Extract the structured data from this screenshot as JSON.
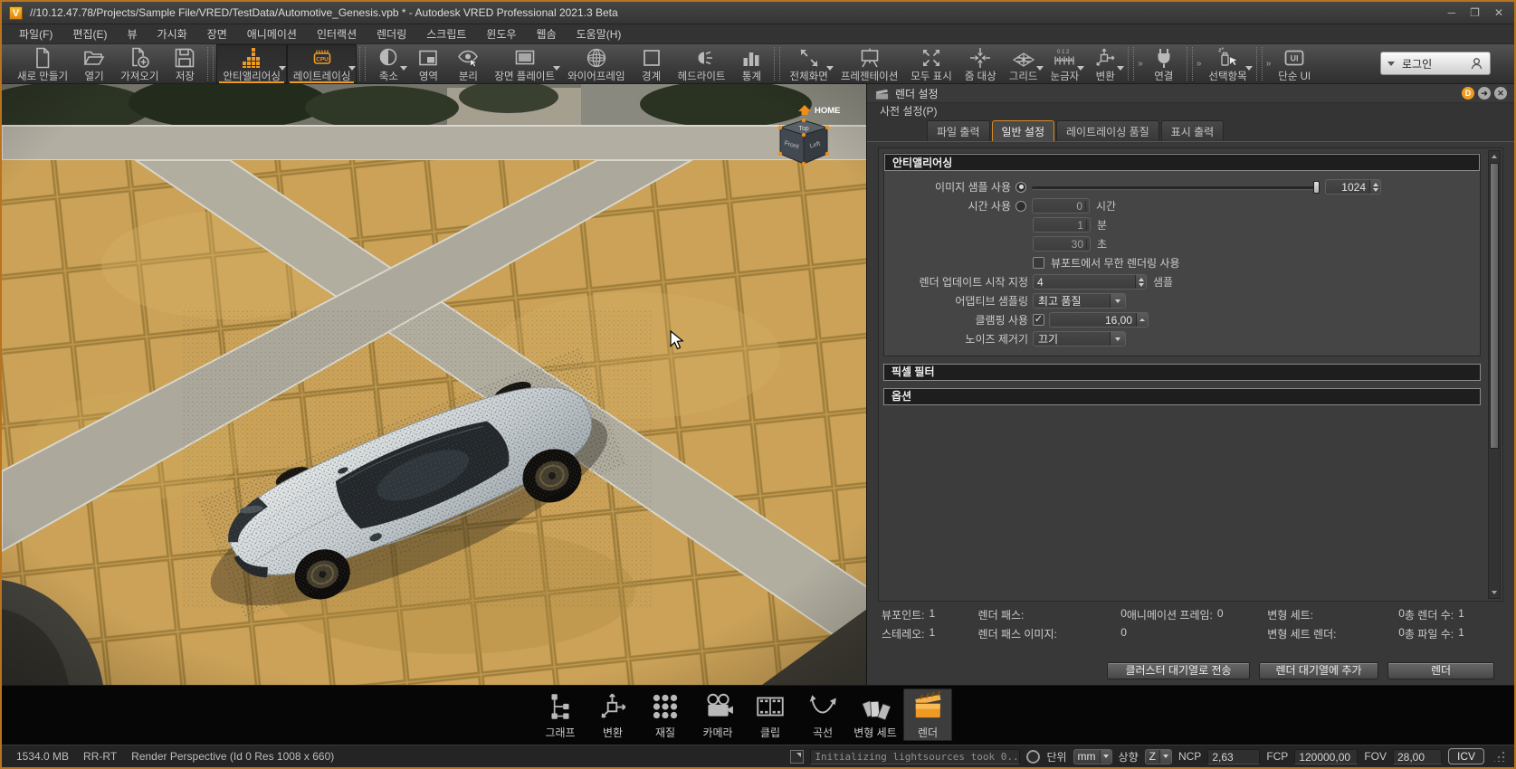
{
  "colors": {
    "accent": "#ef9b23",
    "icon_gray": "#b9b9b9",
    "window_border": "#b9731f"
  },
  "window": {
    "logo_letter": "V",
    "title": "//10.12.47.78/Projects/Sample File/VRED/TestData/Automotive_Genesis.vpb * - Autodesk VRED Professional 2021.3 Beta",
    "controls": {
      "minimize": "─",
      "restore": "❐",
      "close": "✕"
    }
  },
  "menu": {
    "items": [
      {
        "key": "file",
        "label": "파일(F)"
      },
      {
        "key": "edit",
        "label": "편집(E)"
      },
      {
        "key": "view",
        "label": "뷰"
      },
      {
        "key": "visualize",
        "label": "가시화"
      },
      {
        "key": "scene",
        "label": "장면"
      },
      {
        "key": "animation",
        "label": "애니메이션"
      },
      {
        "key": "interaction",
        "label": "인터랙션"
      },
      {
        "key": "rendering",
        "label": "렌더링"
      },
      {
        "key": "script",
        "label": "스크립트"
      },
      {
        "key": "window",
        "label": "윈도우"
      },
      {
        "key": "webshop",
        "label": "웹솜"
      },
      {
        "key": "help",
        "label": "도움말(H)"
      }
    ]
  },
  "toolbar": {
    "chevron": "»",
    "login_label": "로그인",
    "items": [
      {
        "key": "new-file",
        "label": "새로 만들기",
        "icon": "new-file-icon"
      },
      {
        "key": "open",
        "label": "열기",
        "icon": "open-folder-icon"
      },
      {
        "key": "import",
        "label": "가져오기",
        "icon": "import-icon"
      },
      {
        "key": "save",
        "label": "저장",
        "icon": "save-icon"
      },
      {
        "sep": true
      },
      {
        "key": "antialiasing",
        "label": "안티앨리어싱",
        "icon": "antialiasing-icon",
        "active": true,
        "arrow": true
      },
      {
        "key": "raytracing",
        "label": "레이트레이싱",
        "icon": "cpu-icon",
        "active": true,
        "arrow": true
      },
      {
        "sep": true
      },
      {
        "key": "downscale",
        "label": "축소",
        "icon": "downscale-icon",
        "arrow": true
      },
      {
        "key": "region",
        "label": "영역",
        "icon": "region-icon"
      },
      {
        "key": "isolate",
        "label": "분리",
        "icon": "isolate-eye-icon"
      },
      {
        "key": "backplate",
        "label": "장면 플레이트",
        "icon": "backplate-icon",
        "arrow": true
      },
      {
        "key": "wireframe",
        "label": "와이어프레임",
        "icon": "wireframe-globe-icon"
      },
      {
        "key": "boundary",
        "label": "경계",
        "icon": "boundary-icon"
      },
      {
        "key": "headlight",
        "label": "헤드라이트",
        "icon": "headlight-icon"
      },
      {
        "key": "statistics",
        "label": "통계",
        "icon": "statistics-icon"
      },
      {
        "sep": true
      },
      {
        "key": "fullscreen",
        "label": "전체화면",
        "icon": "fullscreen-icon",
        "arrow": true
      },
      {
        "key": "presentation",
        "label": "프레젠테이션",
        "icon": "presentation-icon"
      },
      {
        "key": "show-all",
        "label": "모두 표시",
        "icon": "show-all-icon"
      },
      {
        "key": "zoom-target",
        "label": "줌 대상",
        "icon": "zoom-target-icon"
      },
      {
        "key": "grid",
        "label": "그리드",
        "icon": "grid-icon",
        "arrow": true
      },
      {
        "key": "ruler",
        "label": "눈금자",
        "icon": "ruler-icon",
        "arrow": true
      },
      {
        "key": "transform",
        "label": "변환",
        "icon": "transform-icon",
        "arrow": true
      },
      {
        "sep": true,
        "chevron": true
      },
      {
        "key": "connect",
        "label": "연결",
        "icon": "connect-icon"
      },
      {
        "sep": true,
        "chevron": true
      },
      {
        "key": "selection",
        "label": "선택항목",
        "icon": "selection-icon",
        "arrow": true
      },
      {
        "sep": true,
        "chevron": true
      },
      {
        "key": "simple-ui",
        "label": "단순 UI",
        "icon": "simple-ui-icon"
      }
    ]
  },
  "viewport": {
    "cube": {
      "home": "HOME",
      "top": "Top",
      "front": "Front",
      "left": "Left"
    }
  },
  "panel": {
    "title": "렌더 설정",
    "menu_label": "사전 설정(P)",
    "window_buttons": {
      "detach": "D",
      "arrow": "➜",
      "close": "✕"
    },
    "tabs": [
      {
        "key": "file-output",
        "label": "파일 출력"
      },
      {
        "key": "general-settings",
        "label": "일반 설정",
        "active": true
      },
      {
        "key": "raytracing-quality",
        "label": "레이트레이싱 품질"
      },
      {
        "key": "display-output",
        "label": "표시 출력"
      }
    ],
    "antialiasing": {
      "header": "안티앨리어싱",
      "image_samples_label": "이미지 샘플 사용",
      "image_samples_value": "1024",
      "time_label": "시간 사용",
      "hours_value": "0",
      "hours_unit": "시간",
      "minutes_value": "1",
      "minutes_unit": "분",
      "seconds_value": "30",
      "seconds_unit": "초",
      "infinite_render_label": "뷰포트에서 무한 렌더링 사용",
      "render_update_label": "렌더 업데이트 시작 지정",
      "render_update_value": "4",
      "render_update_unit": "샘플",
      "adaptive_label": "어댑티브 샘플링",
      "adaptive_value": "최고 품질",
      "clamping_label": "클램핑 사용",
      "clamping_value": "16,00",
      "denoiser_label": "노이즈 제거기",
      "denoiser_value": "끄기"
    },
    "pixel_filter_header": "픽셀 필터",
    "options_header": "옵션",
    "stats": [
      [
        {
          "key": "viewpoints",
          "label": "뷰포인트:",
          "value": "1"
        },
        {
          "key": "stereo",
          "label": "스테레오:",
          "value": "1"
        }
      ],
      [
        {
          "key": "render-passes",
          "label": "렌더 패스:",
          "value": "0"
        },
        {
          "key": "render-pass-images",
          "label": "렌더 패스 이미지:",
          "value": "0"
        }
      ],
      [
        {
          "key": "animation-frames",
          "label": "애니메이션 프레임:",
          "value": "0"
        }
      ],
      [
        {
          "key": "variant-sets",
          "label": "변형 세트:",
          "value": "0"
        },
        {
          "key": "variant-set-renders",
          "label": "변형 세트 렌더:",
          "value": "0"
        }
      ],
      [
        {
          "key": "total-renders",
          "label": "총 렌더 수:",
          "value": "1"
        },
        {
          "key": "total-files",
          "label": "총 파일 수:",
          "value": "1"
        }
      ]
    ],
    "buttons": [
      {
        "key": "cluster-queue",
        "label": "클러스터 대기열로 전송"
      },
      {
        "key": "render-queue",
        "label": "렌더 대기열에 추가"
      },
      {
        "key": "render",
        "label": "렌더"
      }
    ]
  },
  "dock": {
    "items": [
      {
        "key": "graph",
        "label": "그래프",
        "icon": "graph-icon"
      },
      {
        "key": "transform",
        "label": "변환",
        "icon": "transform-dock-icon"
      },
      {
        "key": "material",
        "label": "재질",
        "icon": "material-icon"
      },
      {
        "key": "camera",
        "label": "카메라",
        "icon": "camera-icon"
      },
      {
        "key": "clip",
        "label": "클립",
        "icon": "clip-icon"
      },
      {
        "key": "curve",
        "label": "곡선",
        "icon": "curve-icon"
      },
      {
        "key": "variant-sets",
        "label": "변형 세트",
        "icon": "variant-set-icon"
      },
      {
        "key": "render",
        "label": "렌더",
        "icon": "render-clapper-icon",
        "active": true
      }
    ]
  },
  "statusbar": {
    "memory": "1534.0 MB",
    "mode": "RR-RT",
    "view": "Render Perspective (Id 0 Res 1008 x 660)",
    "message": "Initializing lightsources took 0...",
    "unit_label": "단위",
    "unit_value": "mm",
    "up_label": "상향",
    "up_value": "Z",
    "ncp_label": "NCP",
    "ncp_value": "2,63",
    "fcp_label": "FCP",
    "fcp_value": "120000,00",
    "fov_label": "FOV",
    "fov_value": "28,00",
    "icv_label": "ICV"
  }
}
